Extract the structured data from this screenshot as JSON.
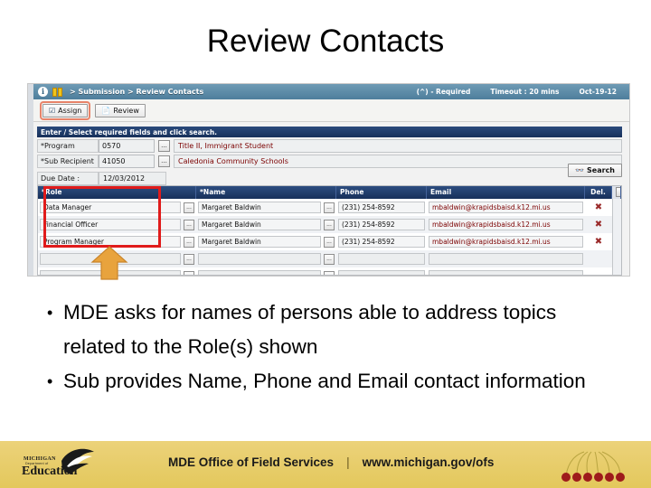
{
  "slide": {
    "title": "Review Contacts"
  },
  "app": {
    "breadcrumb": {
      "info_icon": "info-icon",
      "book_icon": "book-icon",
      "path": "> Submission > Review Contacts",
      "required_note": "(^) - Required",
      "timeout": "Timeout : 20 mins",
      "date": "Oct-19-12"
    },
    "toolbar": {
      "assign_label": "Assign",
      "assign_icon": "checkbox-icon",
      "review_label": "Review",
      "review_icon": "page-icon"
    },
    "instruction": "Enter / Select required fields and click search.",
    "form": {
      "program_label": "*Program",
      "program_code": "0570",
      "program_desc": "Title II, Immigrant Student",
      "subrecipient_label": "*Sub Recipient",
      "subrecipient_code": "41050",
      "subrecipient_desc": "Caledonia Community Schools",
      "duedate_label": "Due Date :",
      "duedate_value": "12/03/2012",
      "search_label": "Search",
      "search_icon": "binoculars-icon",
      "ellipsis_label": "..."
    },
    "grid": {
      "columns": [
        "*Role",
        "*Name",
        "Phone",
        "Email",
        "Del."
      ],
      "rows": [
        {
          "role": "Data Manager",
          "name": "Margaret Baldwin",
          "phone": "(231) 254-8592",
          "email": "mbaldwin@krapidsbaisd.k12.mi.us",
          "del": "✖"
        },
        {
          "role": "Financial Officer",
          "name": "Margaret Baldwin",
          "phone": "(231) 254-8592",
          "email": "mbaldwin@krapidsbaisd.k12.mi.us",
          "del": "✖"
        },
        {
          "role": "Program Manager",
          "name": "Margaret Baldwin",
          "phone": "(231) 254-8592",
          "email": "mbaldwin@krapidsbaisd.k12.mi.us",
          "del": "✖"
        },
        {
          "role": "",
          "name": "",
          "phone": "",
          "email": "",
          "del": ""
        },
        {
          "role": "",
          "name": "",
          "phone": "",
          "email": "",
          "del": ""
        }
      ],
      "scroll_up_icon": "▲"
    },
    "annotations": {
      "highlight_box": "red-box-around-role-column",
      "arrow": "gold-up-arrow"
    }
  },
  "bullets": [
    "MDE asks for names of persons able to address topics related to the Role(s) shown",
    "Sub provides Name, Phone and Email contact information"
  ],
  "footer": {
    "logo_michigan": "MICHIGAN",
    "logo_dept": "Department of",
    "logo_education": "Education",
    "office": "MDE Office of Field Services",
    "separator": "|",
    "url": "www.michigan.gov/ofs"
  },
  "colors": {
    "footer_bg": "#e7cd6a",
    "header_blue": "#1f3864",
    "breadcrumb_blue": "#5d8aa8",
    "highlight_red": "#e01b1b",
    "arrow_gold": "#e8a33d"
  }
}
